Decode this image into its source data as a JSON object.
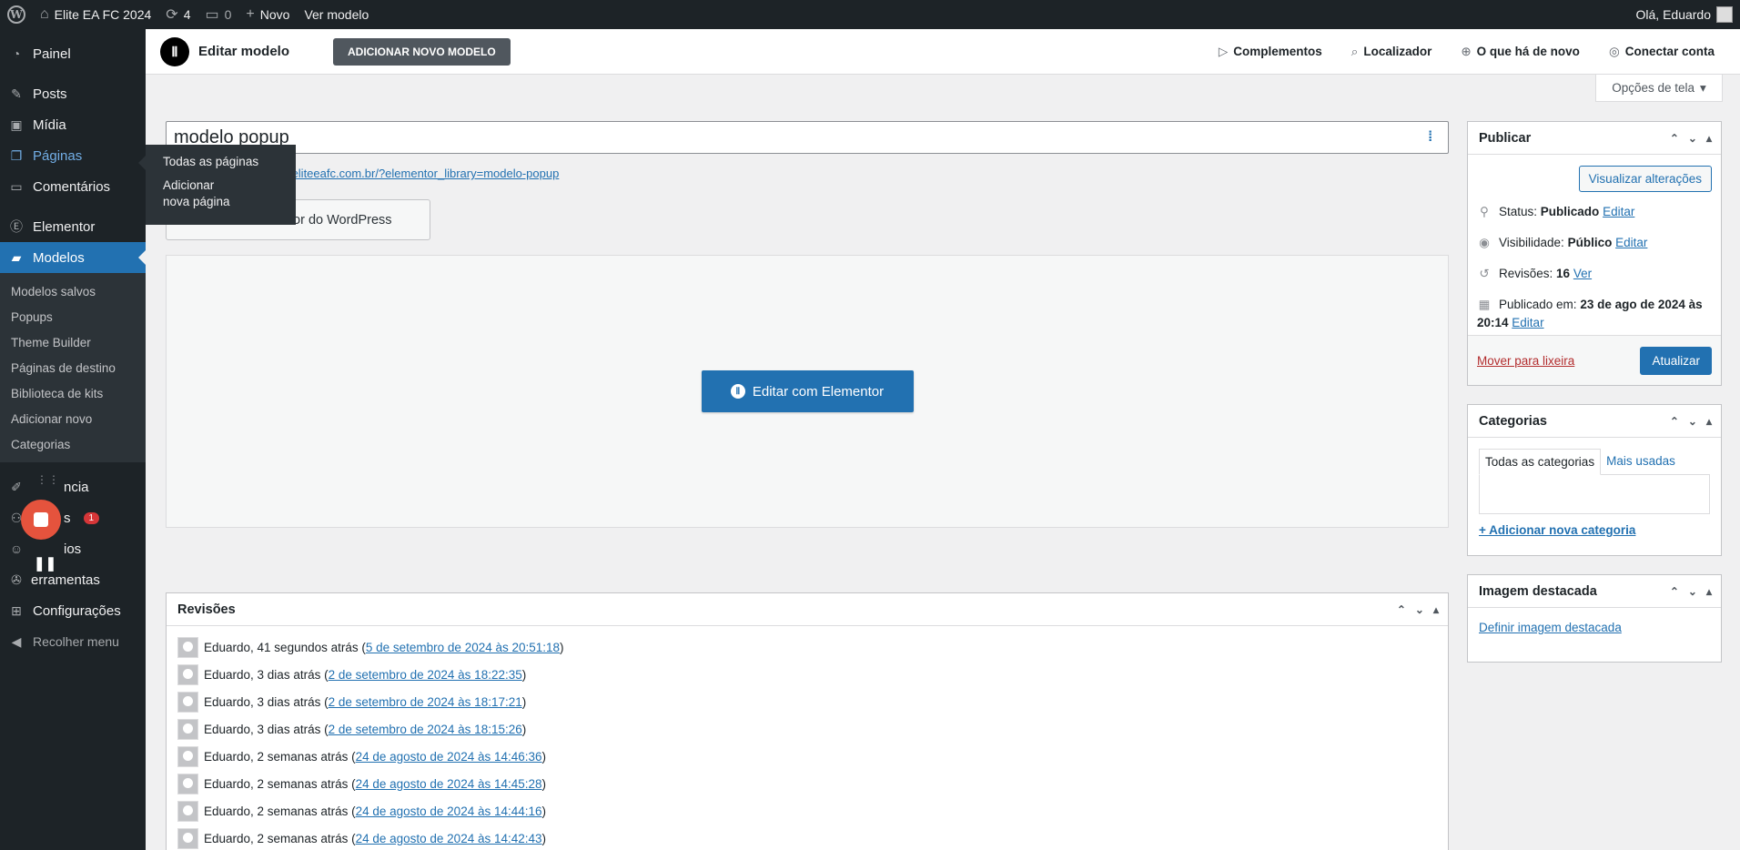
{
  "adminbar": {
    "site_name": "Elite EA FC 2024",
    "updates_count": "4",
    "comments_count": "0",
    "new_label": "Novo",
    "view_label": "Ver modelo",
    "greeting": "Olá, Eduardo"
  },
  "sidebar": {
    "painel": "Painel",
    "posts": "Posts",
    "midia": "Mídia",
    "paginas": "Páginas",
    "comentarios": "Comentários",
    "elementor": "Elementor",
    "modelos": "Modelos",
    "submenu": [
      "Modelos salvos",
      "Popups",
      "Theme Builder",
      "Páginas de destino",
      "Biblioteca de kits",
      "Adicionar novo",
      "Categorias"
    ],
    "aparencia": "ncia",
    "plugins": "s",
    "plugins_badge": "1",
    "usuarios": "ios",
    "ferramentas": "erramentas",
    "configuracoes": "Configurações",
    "recolher": "Recolher menu"
  },
  "flyout": {
    "item1": "Todas as páginas",
    "item2": "Adicionar nova página"
  },
  "header": {
    "title": "Editar modelo",
    "add_new": "ADICIONAR NOVO MODELO",
    "complementos": "Complementos",
    "localizador": "Localizador",
    "novidades": "O que há de novo",
    "conectar": "Conectar conta"
  },
  "screen_options": "Opções de tela",
  "post": {
    "title": "modelo popup",
    "permalink": "ps://eliteeafc.com.br/?elementor_library=modelo-popup",
    "wp_editor_label": "tor do WordPress",
    "edit_elementor": "Editar com Elementor"
  },
  "revisions": {
    "title": "Revisões",
    "rows": [
      {
        "who": "Eduardo, 41 segundos atrás (",
        "link": "5 de setembro de 2024 às 20:51:18",
        "end": ")"
      },
      {
        "who": "Eduardo, 3 dias atrás (",
        "link": "2 de setembro de 2024 às 18:22:35",
        "end": ")"
      },
      {
        "who": "Eduardo, 3 dias atrás (",
        "link": "2 de setembro de 2024 às 18:17:21",
        "end": ")"
      },
      {
        "who": "Eduardo, 3 dias atrás (",
        "link": "2 de setembro de 2024 às 18:15:26",
        "end": ")"
      },
      {
        "who": "Eduardo, 2 semanas atrás (",
        "link": "24 de agosto de 2024 às 14:46:36",
        "end": ")"
      },
      {
        "who": "Eduardo, 2 semanas atrás (",
        "link": "24 de agosto de 2024 às 14:45:28",
        "end": ")"
      },
      {
        "who": "Eduardo, 2 semanas atrás (",
        "link": "24 de agosto de 2024 às 14:44:16",
        "end": ")"
      },
      {
        "who": "Eduardo, 2 semanas atrás (",
        "link": "24 de agosto de 2024 às 14:42:43",
        "end": ")"
      }
    ]
  },
  "publish": {
    "title": "Publicar",
    "preview": "Visualizar alterações",
    "status_label": "Status:",
    "status_value": "Publicado",
    "visibility_label": "Visibilidade:",
    "visibility_value": "Público",
    "revisions_label": "Revisões:",
    "revisions_value": "16",
    "view": "Ver",
    "published_label": "Publicado em:",
    "published_value": "23 de ago de 2024 às",
    "published_time": "20:14",
    "edit": "Editar",
    "trash": "Mover para lixeira",
    "update": "Atualizar"
  },
  "categories": {
    "title": "Categorias",
    "tab_all": "Todas as categorias",
    "tab_used": "Mais usadas",
    "add": "+ Adicionar nova categoria"
  },
  "featured": {
    "title": "Imagem destacada",
    "set": "Definir imagem destacada"
  }
}
